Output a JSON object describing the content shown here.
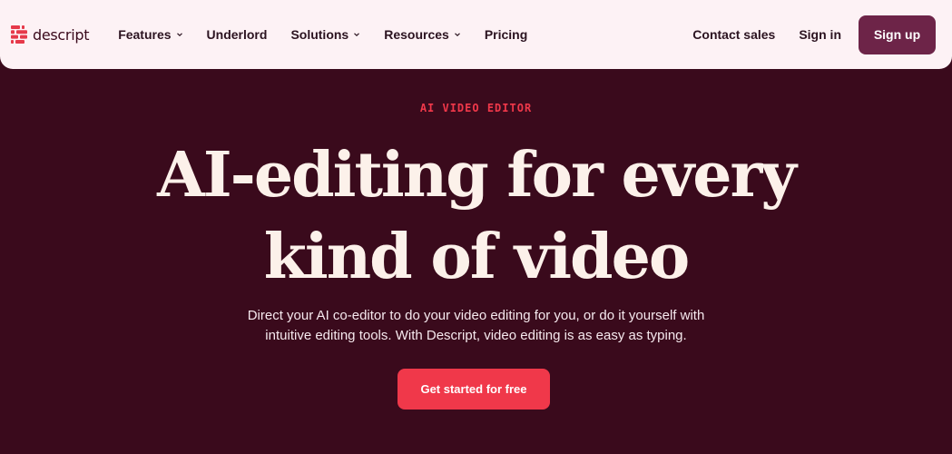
{
  "brand": {
    "name": "descript",
    "logo_icon": "descript-logo-icon",
    "accent": "#e6394a"
  },
  "nav": {
    "items": [
      {
        "label": "Features",
        "has_dropdown": true
      },
      {
        "label": "Underlord",
        "has_dropdown": false
      },
      {
        "label": "Solutions",
        "has_dropdown": true
      },
      {
        "label": "Resources",
        "has_dropdown": true
      },
      {
        "label": "Pricing",
        "has_dropdown": false
      }
    ],
    "contact_sales": "Contact sales",
    "sign_in": "Sign in",
    "sign_up": "Sign up"
  },
  "hero": {
    "eyebrow": "AI VIDEO EDITOR",
    "headline_line1": "AI-editing for every",
    "headline_line2": "kind of video",
    "subtext_line1": "Direct your AI co-editor to do your video editing for you, or do it yourself with",
    "subtext_line2": "intuitive editing tools. With Descript, video editing is as easy as typing.",
    "cta_label": "Get started for free"
  },
  "colors": {
    "nav_bg": "#fdf2f5",
    "hero_bg": "#3a0a1c",
    "signup_bg": "#6d2448",
    "cta_bg": "#f0384a",
    "eyebrow": "#f0384a",
    "headline": "#fcf1ea"
  }
}
